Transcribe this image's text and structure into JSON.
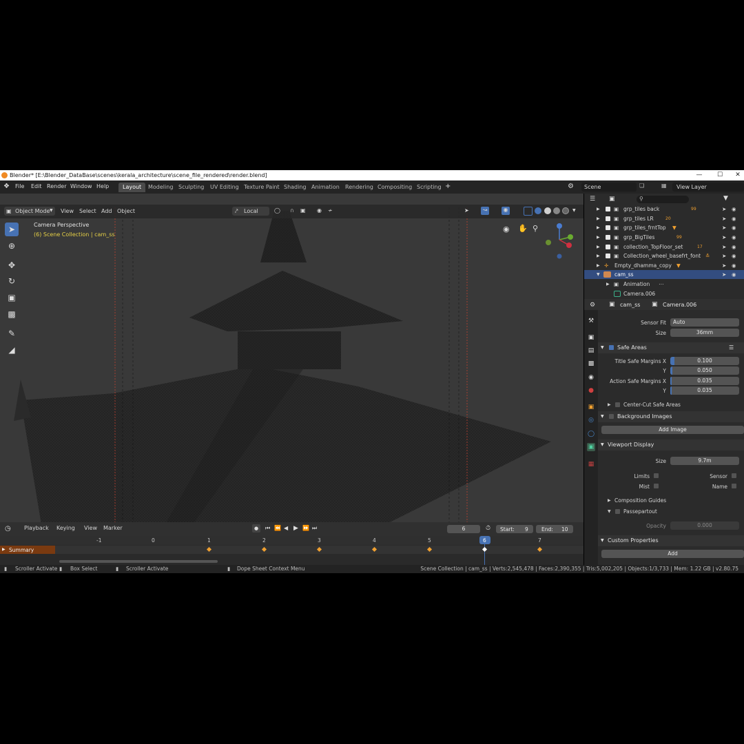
{
  "window": {
    "title": "Blender* [E:\\Blender_DataBase\\scenes\\kerala_architecture\\scene_file_rendered\\render.blend]",
    "minimize": "—",
    "maximize": "☐",
    "close": "✕"
  },
  "menu": {
    "items": [
      "File",
      "Edit",
      "Render",
      "Window",
      "Help"
    ],
    "workspaces": [
      "Layout",
      "Modeling",
      "Sculpting",
      "UV Editing",
      "Texture Paint",
      "Shading",
      "Animation",
      "Rendering",
      "Compositing",
      "Scripting"
    ],
    "add_tab": "+",
    "scene_label": "Scene",
    "view_layer_label": "View Layer"
  },
  "viewport": {
    "mode": "Object Mode",
    "menus": [
      "View",
      "Select",
      "Add",
      "Object"
    ],
    "orientation": "Local",
    "overlay_title": "Camera Perspective",
    "overlay_subtitle": "(6) Scene Collection | cam_ss",
    "accent_color": "#4772b3",
    "subtitle_color": "#e6d046"
  },
  "outliner": {
    "rows": [
      {
        "name": "grp_tiles back",
        "badge": "99"
      },
      {
        "name": "grp_tiles LR",
        "badge": "20"
      },
      {
        "name": "grp_tiles_frntTop",
        "badge": ""
      },
      {
        "name": "grp_BigTiles",
        "badge": "99"
      },
      {
        "name": "collection_TopFloor_set",
        "badge": "17"
      },
      {
        "name": "Collection_wheel_basefrt_font",
        "badge": ""
      },
      {
        "name": "Empty_dhamma_copy",
        "badge": ""
      },
      {
        "name": "cam_ss",
        "badge": ""
      },
      {
        "name": "Animation",
        "badge": ""
      },
      {
        "name": "Camera.006",
        "badge": ""
      }
    ]
  },
  "properties": {
    "object_name": "cam_ss",
    "data_name": "Camera.006",
    "sensor_fit_label": "Sensor Fit",
    "sensor_fit_value": "Auto",
    "size_label": "Size",
    "size_value": "36mm",
    "safe_areas": "Safe Areas",
    "title_safe_x_label": "Title Safe Margins X",
    "title_safe_x": "0.100",
    "y_label": "Y",
    "title_safe_y": "0.050",
    "action_safe_x_label": "Action Safe Margins X",
    "action_safe_x": "0.035",
    "action_safe_y": "0.035",
    "center_cut": "Center-Cut Safe Areas",
    "background_images": "Background Images",
    "add_image": "Add Image",
    "viewport_display": "Viewport Display",
    "vd_size_label": "Size",
    "vd_size_value": "9.7m",
    "limits": "Limits",
    "sensor": "Sensor",
    "mist": "Mist",
    "name": "Name",
    "composition_guides": "Composition Guides",
    "passepartout": "Passepartout",
    "opacity_label": "Opacity",
    "opacity_value": "0.000",
    "custom_properties": "Custom Properties",
    "add": "Add"
  },
  "timeline": {
    "menus": [
      "Playback",
      "Keying",
      "View",
      "Marker"
    ],
    "current_frame": "6",
    "start_label": "Start:",
    "start_value": "9",
    "end_label": "End:",
    "end_value": "10",
    "summary": "Summary",
    "ticks": [
      "-1",
      "0",
      "1",
      "2",
      "3",
      "4",
      "5",
      "6",
      "7"
    ],
    "current_badge": "6"
  },
  "status": {
    "left1": "Scroller Activate",
    "left2": "Box Select",
    "left3": "Scroller Activate",
    "left4": "Dope Sheet Context Menu",
    "right": "Scene Collection | cam_ss | Verts:2,545,478 | Faces:2,390,355 | Tris:5,002,205 | Objects:1/3,733 | Mem: 1.22 GB | v2.80.75"
  }
}
